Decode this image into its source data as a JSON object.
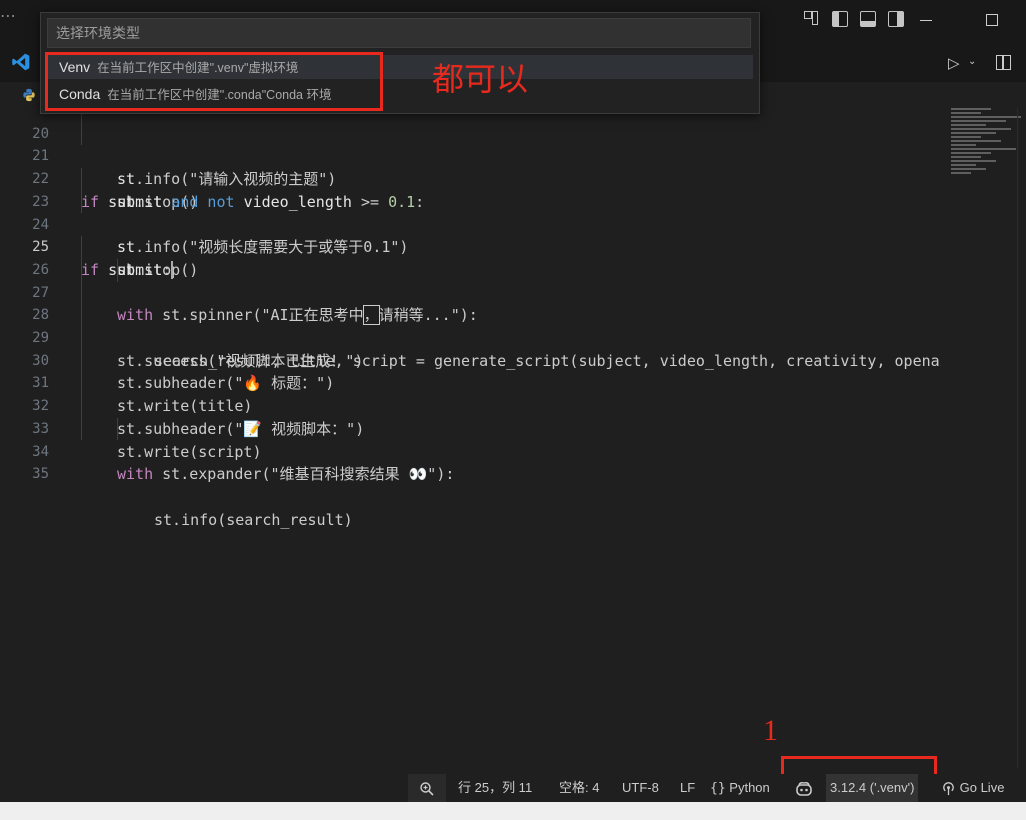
{
  "quickpick": {
    "placeholder": "选择环境类型",
    "items": [
      {
        "label": "Venv",
        "description": "在当前工作区中创建\".venv\"虚拟环境"
      },
      {
        "label": "Conda",
        "description": "在当前工作区中创建\".conda\"Conda 环境"
      }
    ]
  },
  "annotations": {
    "both_ok": "都可以",
    "step": "1",
    "color": "#e8291e"
  },
  "editor": {
    "lines": [
      {
        "n": "20",
        "tokens": [
          {
            "t": "st",
            "c": "white"
          },
          {
            "t": ".info(\"请输入视频的主题\")",
            "c": "plain"
          }
        ]
      },
      {
        "n": "21",
        "tokens": [
          {
            "t": "st",
            "c": "white"
          },
          {
            "t": ".stop()",
            "c": "plain"
          }
        ]
      },
      {
        "n": "22",
        "tokens": [
          {
            "t": "if",
            "c": "ctl"
          },
          {
            "t": " ",
            "c": "plain"
          },
          {
            "t": "submit",
            "c": "white"
          },
          {
            "t": " and not ",
            "c": "kw"
          },
          {
            "t": "video_length",
            "c": "white"
          },
          {
            "t": " >= ",
            "c": "plain"
          },
          {
            "t": "0.1",
            "c": "num"
          },
          {
            "t": ":",
            "c": "plain"
          }
        ]
      },
      {
        "n": "23",
        "tokens": [
          {
            "t": "st",
            "c": "white"
          },
          {
            "t": ".info(",
            "c": "plain"
          },
          {
            "t": "\"视频长度需要大于或等于0.1\"",
            "c": "plain"
          },
          {
            "t": ")",
            "c": "plain"
          }
        ]
      },
      {
        "n": "24",
        "tokens": [
          {
            "t": "st",
            "c": "white"
          },
          {
            "t": ".stop()",
            "c": "plain"
          }
        ]
      },
      {
        "n": "25",
        "tokens": [
          {
            "t": "if",
            "c": "ctl"
          },
          {
            "t": " ",
            "c": "plain"
          },
          {
            "t": "submit",
            "c": "white"
          },
          {
            "t": ":",
            "c": "plain"
          }
        ]
      },
      {
        "n": "26",
        "tokens": [
          {
            "t": "with",
            "c": "ctl"
          },
          {
            "t": " st.spinner(",
            "c": "plain"
          },
          {
            "t": "\"AI正在思考中",
            "c": "plain"
          },
          {
            "t": "，",
            "c": "box"
          },
          {
            "t": "请稍等...\"",
            "c": "plain"
          },
          {
            "t": "):",
            "c": "plain"
          }
        ]
      },
      {
        "n": "27",
        "tokens": [
          {
            "t": "search_result, title, script = generate_script(subject, video_length, creativity, openai_api_key)",
            "c": "plain"
          }
        ]
      },
      {
        "n": "28",
        "tokens": [
          {
            "t": "st.success(",
            "c": "plain"
          },
          {
            "t": "\"视频脚本已生成！\"",
            "c": "plain"
          },
          {
            "t": ")",
            "c": "plain"
          }
        ]
      },
      {
        "n": "29",
        "tokens": [
          {
            "t": "st.subheader(",
            "c": "plain"
          },
          {
            "t": "\"🔥 标题：\"",
            "c": "plain"
          },
          {
            "t": ")",
            "c": "plain"
          }
        ]
      },
      {
        "n": "30",
        "tokens": [
          {
            "t": "st.write(title)",
            "c": "plain"
          }
        ]
      },
      {
        "n": "31",
        "tokens": [
          {
            "t": "st.subheader(",
            "c": "plain"
          },
          {
            "t": "\"📝 视频脚本：\"",
            "c": "plain"
          },
          {
            "t": ")",
            "c": "plain"
          }
        ]
      },
      {
        "n": "32",
        "tokens": [
          {
            "t": "st.write(script)",
            "c": "plain"
          }
        ]
      },
      {
        "n": "33",
        "tokens": [
          {
            "t": "with",
            "c": "ctl"
          },
          {
            "t": " st.expander(",
            "c": "plain"
          },
          {
            "t": "\"维基百科搜索结果 👀\"",
            "c": "plain"
          },
          {
            "t": "):",
            "c": "plain"
          }
        ]
      },
      {
        "n": "34",
        "tokens": [
          {
            "t": "st.info(search_result)",
            "c": "plain"
          }
        ]
      },
      {
        "n": "35",
        "tokens": []
      }
    ]
  },
  "statusbar": {
    "position": "行 25，列 11",
    "spaces": "空格: 4",
    "encoding": "UTF-8",
    "eol": "LF",
    "language": "Python",
    "interpreter": "3.12.4 ('.venv')",
    "golive": "Go Live"
  },
  "icons": {
    "zoom": "zoom-in-icon",
    "copilot": "copilot-icon",
    "golive": "broadcast-icon",
    "braces": "braces-icon"
  }
}
